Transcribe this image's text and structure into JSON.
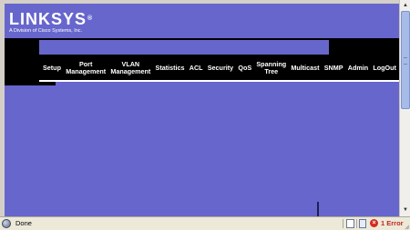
{
  "logo": {
    "wordmark": "LINKSYS",
    "registered": "®",
    "subtitle": "A Division of Cisco Systems, Inc."
  },
  "menu": {
    "items": [
      {
        "label": "Setup"
      },
      {
        "label": "Port\nManagement"
      },
      {
        "label": "VLAN\nManagement"
      },
      {
        "label": "Statistics"
      },
      {
        "label": "ACL"
      },
      {
        "label": "Security"
      },
      {
        "label": "QoS"
      },
      {
        "label": "Spanning\nTree"
      },
      {
        "label": "Multicast"
      },
      {
        "label": "SNMP"
      },
      {
        "label": "Admin"
      },
      {
        "label": "LogOut"
      }
    ]
  },
  "statusbar": {
    "text": "Done",
    "error_count": "1 Error"
  },
  "colors": {
    "page_background": "#6766cc",
    "menu_background": "#000000",
    "menu_text": "#ffffff",
    "error": "#c0281e"
  },
  "icons": {
    "scroll_up": "chevron-up-icon",
    "scroll_down": "chevron-down-icon",
    "status": "globe-icon",
    "error": "error-icon"
  }
}
